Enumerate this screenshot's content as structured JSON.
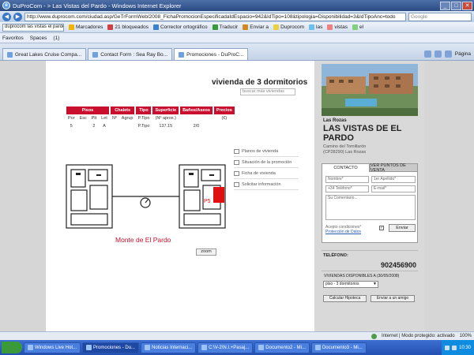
{
  "window": {
    "title": "DuProCom - > Las Vistas del Pardo - Windows Internet Explorer",
    "ie_icon": "e",
    "buttons": {
      "minimize": "_",
      "maximize": "□",
      "close": "✕"
    }
  },
  "address": {
    "url": "http://www.duprocom.com/ciudad.asp/GeTrFormWeb/2008_FichaPromocionEspecificadaIdEspacio=942&IdTipo=108&tipologia=Disponibilidad=3&IdTipoAnc=todo",
    "search_placeholder": "Google",
    "back": "◀",
    "forward": "▶"
  },
  "google_toolbar": {
    "query": "duprocom las vistas el pardo",
    "items": [
      {
        "label": "Marcadores",
        "icon": "star-icon",
        "color": "#f0b400"
      },
      {
        "label": "21 bloqueados",
        "icon": "popup-blocked-icon",
        "color": "#d04040"
      },
      {
        "label": "Corrector ortográfico",
        "icon": "spellcheck-icon",
        "color": "#3a7fd0"
      },
      {
        "label": "Traducir",
        "icon": "translate-icon",
        "color": "#3a9a3a"
      },
      {
        "label": "Enviar a",
        "icon": "send-icon",
        "color": "#d08a20"
      },
      {
        "label": "Duprocom",
        "icon": "highlight-icon",
        "color": "#e8d040"
      },
      {
        "label": "las",
        "icon": "highlight-icon",
        "color": "#6ac0f0"
      },
      {
        "label": "vistas",
        "icon": "highlight-icon",
        "color": "#f08080"
      },
      {
        "label": "el",
        "icon": "highlight-icon",
        "color": "#80d080"
      }
    ]
  },
  "links_toolbar": {
    "items": [
      "Favoritos",
      "Spaces",
      "(1)"
    ]
  },
  "tabs": [
    {
      "label": "Great Lakes Cruise Compa...",
      "active": false
    },
    {
      "label": "Contact Form : Sea Ray Bo...",
      "active": false
    },
    {
      "label": "Promociones - DuProC...",
      "active": true
    }
  ],
  "tab_tools": {
    "page": "Página",
    "tools": "Herramientas"
  },
  "page": {
    "heading": "vivienda de 3 dormitorios",
    "search_small": "buscar más viviendas",
    "specs": {
      "headers": [
        "Pisos",
        "Chalets",
        "Tipo",
        "Superficie",
        "Baños/Aseos",
        "Precios"
      ],
      "subheaders": [
        "Por",
        "Esc",
        "Plt",
        "Let",
        "Nº",
        "Agrup",
        "P.Tipo",
        "(Nº aprox.)",
        "",
        "(€)"
      ],
      "values": [
        "5",
        "",
        "2",
        "A",
        "",
        "",
        "P.Tipo",
        "137.15",
        "2/0",
        ""
      ]
    },
    "plan_label": "P5",
    "plan_title": "Monte de El Pardo",
    "zoom": "zoom",
    "actions": [
      {
        "label": "Planos de vivienda",
        "icon": "floorplan-icon"
      },
      {
        "label": "Situación de la promoción",
        "icon": "map-icon"
      },
      {
        "label": "Ficha de vivienda",
        "icon": "document-icon"
      },
      {
        "label": "Solicitar información",
        "icon": "mail-icon"
      }
    ]
  },
  "sidebar": {
    "location": "Las Rozas",
    "name": "LAS VISTAS DE EL PARDO",
    "address_line1": "Camino del Tomillarón",
    "address_line2": "(CP28290) Las Rozas",
    "tabs": [
      "CONTACTO",
      "VER PUNTOS DE VENTA"
    ],
    "form": {
      "nombre": "Nombre*",
      "apellidos": "1er Apellido*",
      "prefijo": "+34",
      "telefono": "Teléfono*",
      "email": "E-mail*",
      "comentario": "Su Comentario...",
      "legal_line1": "Acepto condiciones*",
      "legal_link": "Protección de Datos",
      "check": "✓",
      "send": "Enviar"
    },
    "telefono_label": "TELÉFONO:",
    "telefono": "902456900",
    "availability_label": "VIVIENDAS DISPONIBLES A (30/05/2008)",
    "select_value": "piso - 3 dormitorios",
    "btn_hipoteca": "Calcular Hipoteca",
    "btn_amigo": "Enviar a un amigo"
  },
  "status": {
    "zone": "Internet | Modo protegido: activado",
    "zoom": "100%"
  },
  "taskbar": {
    "items": [
      {
        "label": "Windows Live Hot...",
        "active": false
      },
      {
        "label": "Promociones - Du...",
        "active": true
      },
      {
        "label": "Noticias Internaci...",
        "active": false
      },
      {
        "label": "C:\\V-2\\N.I.+Pasaj...",
        "active": false
      },
      {
        "label": "Documento2 - Mi...",
        "active": false
      },
      {
        "label": "Documento3 - Mi...",
        "active": false
      }
    ],
    "clock": "10:30"
  }
}
